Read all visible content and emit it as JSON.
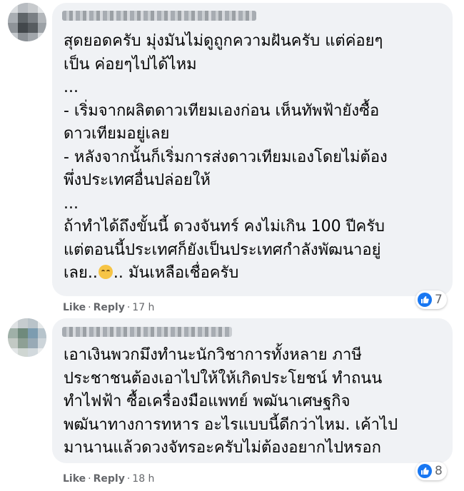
{
  "comments": [
    {
      "text_lines": [
        "สุดยอดครับ มุ่งมันไม่ดูถูกความฝันครับ แต่ค่อยๆ",
        "เป็น ค่อยๆไปได้ไหม",
        "...",
        "- เริ่มจากผลิตดาวเทียมเองก่อน เห็นทัพฟ้ายังซื้อ",
        "ดาวเทียมอยู่เลย",
        "- หลังจากนั้นก็เริ่มการส่งดาวเทียมเองโดยไม่ต้อง",
        "พึ่งประเทศอื่นปล่อยให้",
        "...",
        "ถ้าทำได้ถึงขั้นนี้ ดวงจันทร์ คงไม่เกิน 100 ปีครับ",
        "แต่ตอนนี้ประเทศก็ยังเป็นประเทศกำลังพัฒนาอยู่"
      ],
      "last_line_before_emoji": "เลย..",
      "last_line_after_emoji": ".. มันเหลือเชื่อครับ",
      "emoji_icon": "smiling-face-emoji",
      "like_label": "Like",
      "reply_label": "Reply",
      "separator": "·",
      "time": "17 h",
      "reaction_count": "7",
      "reaction_icon": "thumbs-up-icon"
    },
    {
      "text_lines": [
        "เอาเงินพวกมึงทำนะนักวิชาการทั้งหลาย ภาษี",
        "ประชาชนต้องเอาไปให้ให้เกิดประโยชน์ ทำถนน",
        "ทำไฟฟ้า ซื้อเครื่องมือแพทย์ พฒันาเศษฐกิจ",
        "พฒันาทางการทหาร อะไรแบบนี้ดีกว่าไหม. เค้าไป",
        "มานานแล้วดวงจัทรอะครับไม่ต้องอยากไปหรอก"
      ],
      "like_label": "Like",
      "reply_label": "Reply",
      "separator": "·",
      "time": "18 h",
      "reaction_count": "8",
      "reaction_icon": "thumbs-up-icon"
    }
  ],
  "colors": {
    "bubble": "#f0f2f5",
    "text": "#050505",
    "meta": "#65676b",
    "like_blue": "#1877f2"
  }
}
